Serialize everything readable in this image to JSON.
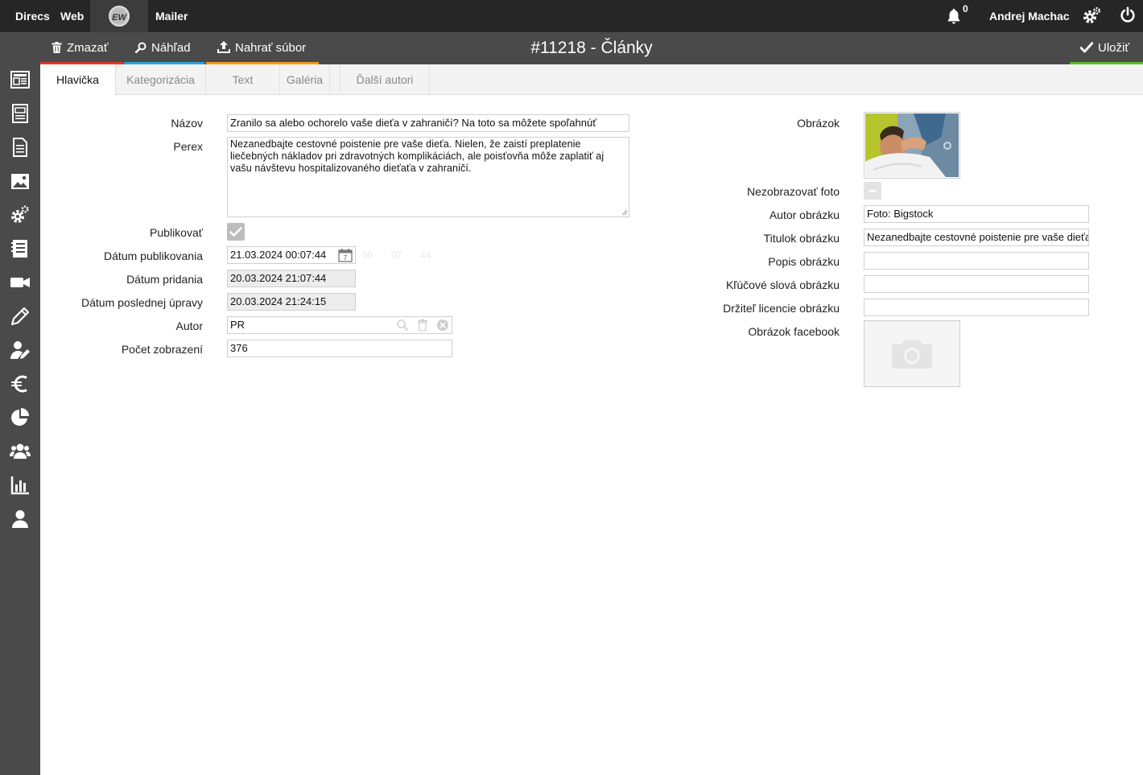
{
  "topbar": {
    "nav": [
      "Direcs",
      "Web",
      "Mailer"
    ],
    "logo_text": "EW",
    "notifications_count": "0",
    "user_name": "Andrej Machac"
  },
  "toolbar": {
    "delete_label": "Zmazať",
    "preview_label": "Náhľad",
    "upload_label": "Nahrať súbor",
    "page_title": "#11218 - Články",
    "save_label": "Uložiť",
    "underline_colors": {
      "delete": "#e2372b",
      "preview": "#2aa3d8",
      "upload": "#f29a1b",
      "save": "#5cb82c"
    }
  },
  "sidebar": {
    "icons": [
      "news-icon",
      "page-icon",
      "document-icon",
      "gallery-icon",
      "settings-icon",
      "list-icon",
      "video-icon",
      "pencil-icon",
      "user-edit-icon",
      "euro-icon",
      "pie-chart-icon",
      "users-icon",
      "bar-chart-icon",
      "user-icon"
    ]
  },
  "tabs": [
    "Hlavička",
    "Kategorizácia",
    "Text",
    "Galéria",
    "Ďalší autori"
  ],
  "form": {
    "nazov_label": "Názov",
    "nazov_value": "Zranilo sa alebo ochorelo vaše dieťa v zahraničí? Na toto sa môžete spoľahnúť",
    "perex_label": "Perex",
    "perex_value": "Nezanedbajte cestovné poistenie pre vaše dieťa. Nielen, že zaistí preplatenie liečebných nákladov pri zdravotných komplikáciách, ale poisťovňa môže zaplatiť aj vašu návštevu hospitalizovaného dieťaťa v zahraničí.",
    "publikovat_label": "Publikovať",
    "datum_publikovania_label": "Dátum publikovania",
    "datum_publikovania_value": "21.03.2024 00:07:44",
    "time_hint_h": "00",
    "time_hint_m": "07",
    "time_hint_s": "44",
    "datum_pridania_label": "Dátum pridania",
    "datum_pridania_value": "20.03.2024 21:07:44",
    "datum_upravy_label": "Dátum poslednej úpravy",
    "datum_upravy_value": "20.03.2024 21:24:15",
    "autor_label": "Autor",
    "autor_value": "PR",
    "pocet_label": "Počet zobrazení",
    "pocet_value": "376"
  },
  "image_panel": {
    "obrazok_label": "Obrázok",
    "nezobrazovat_label": "Nezobrazovať foto",
    "autor_obrazku_label": "Autor obrázku",
    "autor_obrazku_value": "Foto: Bigstock",
    "titulok_label": "Titulok obrázku",
    "titulok_value": "Nezanedbajte cestovné poistenie pre vaše dieťa",
    "popis_label": "Popis obrázku",
    "popis_value": "",
    "klucove_label": "Kľúčové slová obrázku",
    "klucove_value": "",
    "drzitel_label": "Držiteľ licencie obrázku",
    "drzitel_value": "",
    "facebook_label": "Obrázok facebook"
  }
}
